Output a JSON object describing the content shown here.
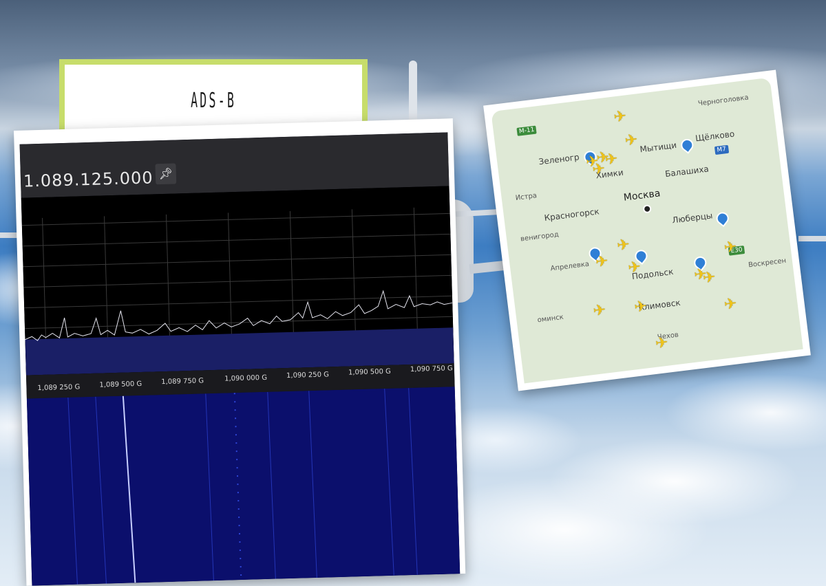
{
  "title": "ADS-B",
  "sdr": {
    "frequency": "1.089.125.000",
    "pin_icon": "pin-icon",
    "axis_ticks": [
      "1,089 250 G",
      "1,089 500 G",
      "1,089 750 G",
      "1,090 000 G",
      "1,090 250 G",
      "1,090 500 G",
      "1,090 750 G"
    ]
  },
  "map": {
    "cities": {
      "moscow": "Москва",
      "zelenograd": "Зеленогр",
      "khimki": "Химки",
      "mytishchi": "Мытищи",
      "shchelkovo": "Щёлково",
      "chernogolovka": "Черноголовка",
      "istra": "Истра",
      "balashikha": "Балашиха",
      "krasnogorsk": "Красногорск",
      "zvenigorod": "венигород",
      "lyubertsy": "Люберцы",
      "aprelevka": "Апрелевка",
      "podolsk": "Подольск",
      "voskresensk": "Воскресен",
      "fominsk": "оминск",
      "klimovsk": "Климовск",
      "chekhov": "Чехов"
    },
    "roads": {
      "m11": "M-11",
      "m7": "M7",
      "e30": "E30"
    }
  }
}
